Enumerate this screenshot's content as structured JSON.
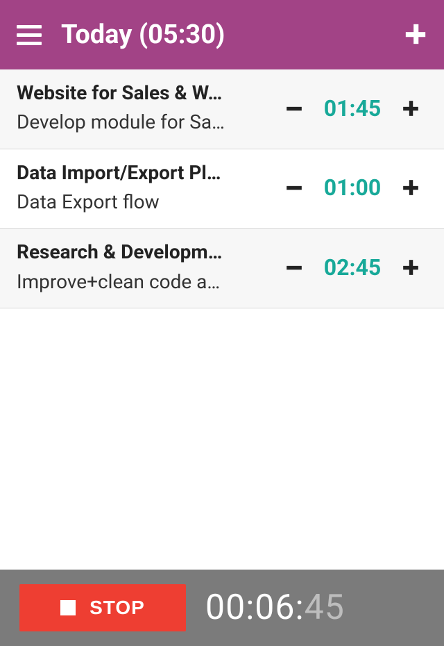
{
  "header": {
    "title": "Today (05:30)"
  },
  "colors": {
    "accent": "#18A999",
    "header_bg": "#A24386",
    "stop_bg": "#EE3E32",
    "footer_bg": "#7b7b7b"
  },
  "items": [
    {
      "title": "Website for Sales & W…",
      "subtitle": "Develop module for Sa…",
      "duration": "01:45"
    },
    {
      "title": "Data Import/Export Plu…",
      "subtitle": "Data Export flow",
      "duration": "01:00"
    },
    {
      "title": "Research & Developme…",
      "subtitle": "Improve+clean code an…",
      "duration": "02:45"
    }
  ],
  "footer": {
    "stop_label": "STOP",
    "timer_main": "00:06:",
    "timer_dim": "45"
  }
}
